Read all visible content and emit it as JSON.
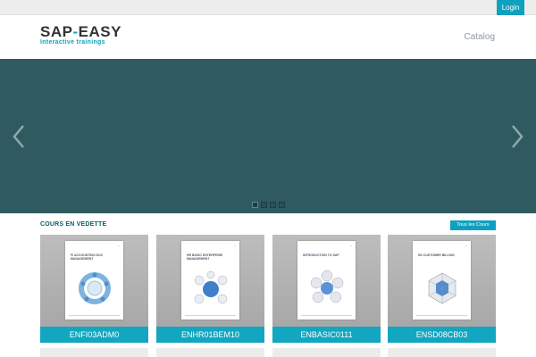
{
  "topbar": {
    "login_label": "Login"
  },
  "header": {
    "logo_sap": "SAP",
    "logo_dash": "-",
    "logo_easy": "EASY",
    "logo_tagline": "Interactive trainings",
    "catalog_label": "Catalog"
  },
  "slider": {
    "slide_count": 4,
    "active_slide": 1
  },
  "featured": {
    "title": "COURS EN VEDETTE",
    "all_courses_label": "Tous les Cours",
    "courses": [
      {
        "code": "ENFI03ADM0",
        "cover_title": "FI ACCOUNTING DOC MANAGEMENT",
        "art": "cycle-diagram"
      },
      {
        "code": "ENHR01BEM10",
        "cover_title": "HR BASIC ENTERPRISE MANAGEMENT",
        "art": "sphere-diagram"
      },
      {
        "code": "ENBASIC0111",
        "cover_title": "INTRODUCTION TO SAP",
        "art": "hub-diagram"
      },
      {
        "code": "ENSD08CB03",
        "cover_title": "SD CUSTOMER BILLING",
        "art": "hexagon-diagram"
      }
    ]
  },
  "colors": {
    "accent": "#0ea1bf",
    "slider_bg": "#2f5a60",
    "heading": "#0c5d69"
  }
}
